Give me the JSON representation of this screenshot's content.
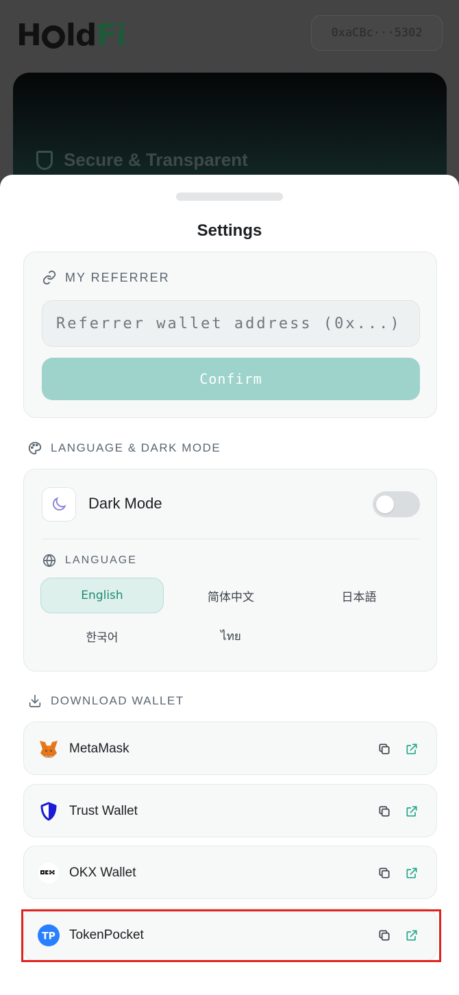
{
  "header": {
    "logo_text": "HoldFi",
    "wallet_address": "0xaCBc···5302"
  },
  "hero": {
    "title": "Secure & Transparent"
  },
  "sheet": {
    "title": "Settings",
    "referrer": {
      "label": "MY REFERRER",
      "input_placeholder": "Referrer wallet address (0x...)",
      "input_value": "",
      "confirm_label": "Confirm"
    },
    "language_section": {
      "heading": "LANGUAGE & DARK MODE",
      "dark_mode_label": "Dark Mode",
      "dark_mode_on": false,
      "language_label": "LANGUAGE",
      "selected": "English",
      "options": [
        "English",
        "简体中文",
        "日本語",
        "한국어",
        "ไทย"
      ]
    },
    "download": {
      "heading": "DOWNLOAD WALLET",
      "wallets": [
        {
          "name": "MetaMask",
          "icon": "metamask-fox-icon"
        },
        {
          "name": "Trust Wallet",
          "icon": "trust-shield-icon"
        },
        {
          "name": "OKX Wallet",
          "icon": "okx-icon"
        },
        {
          "name": "TokenPocket",
          "icon": "tokenpocket-icon"
        }
      ]
    }
  },
  "colors": {
    "accent": "#1e8a73",
    "confirm_bg": "#9dd3cb",
    "highlight": "#e0201d"
  }
}
